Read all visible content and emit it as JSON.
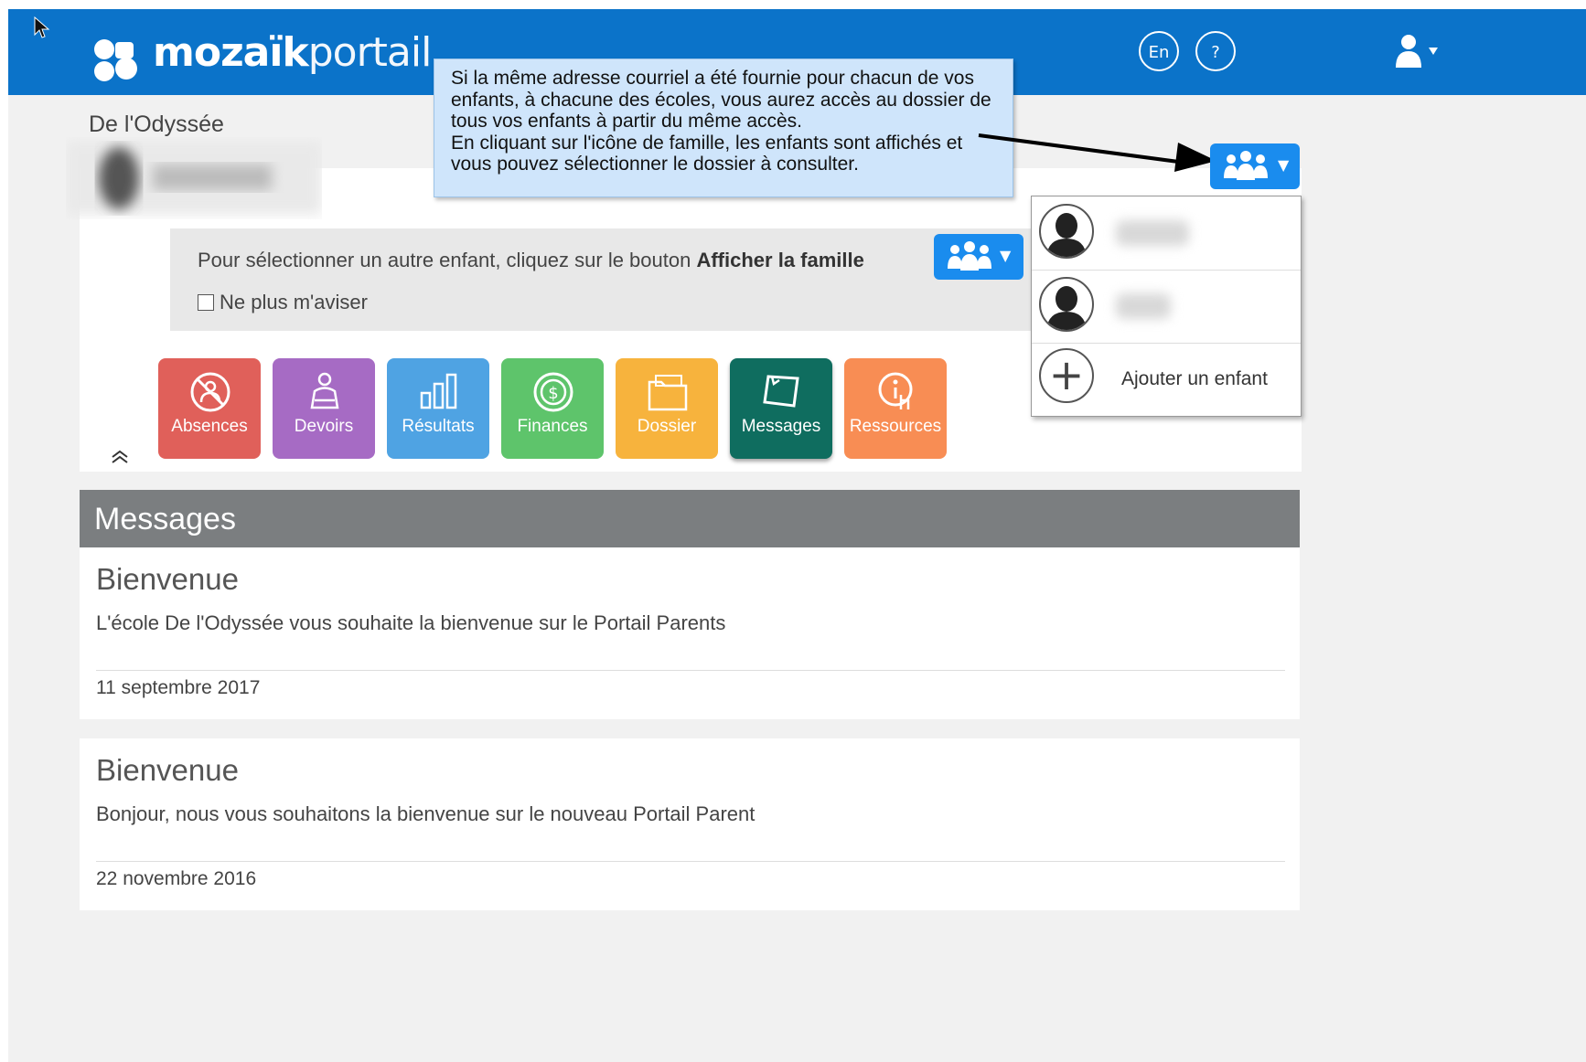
{
  "header": {
    "brand_bold": "mozaïk",
    "brand_light": "portail",
    "lang_button": "En",
    "help_button": "?",
    "color": "#0b73c9"
  },
  "school_name": "De l'Odyssée",
  "notice": {
    "text_prefix": "Pour sélectionner un autre enfant, cliquez sur le bouton ",
    "text_bold": "Afficher la famille",
    "checkbox_label": "Ne plus m'aviser"
  },
  "callout": {
    "lines": [
      "Si la même adresse courriel a été fournie pour chacun de vos",
      "enfants, à chacune des écoles, vous aurez accès au dossier de",
      "tous vos enfants à partir du même accès.",
      "En cliquant sur l'icône de famille, les enfants sont affichés et",
      "vous pouvez sélectionner le dossier à consulter."
    ]
  },
  "family_dropdown": {
    "add_child": "Ajouter un enfant"
  },
  "tiles": [
    {
      "label": "Absences",
      "color": "#e0605a",
      "icon": "absences-icon"
    },
    {
      "label": "Devoirs",
      "color": "#a66bc4",
      "icon": "devoirs-icon"
    },
    {
      "label": "Résultats",
      "color": "#4fa3e3",
      "icon": "resultats-icon"
    },
    {
      "label": "Finances",
      "color": "#5ec46b",
      "icon": "finances-icon"
    },
    {
      "label": "Dossier",
      "color": "#f7b33d",
      "icon": "dossier-icon"
    },
    {
      "label": "Messages",
      "color": "#0f6d5f",
      "icon": "messages-icon"
    },
    {
      "label": "Ressources",
      "color": "#f88d54",
      "icon": "ressources-icon"
    }
  ],
  "messages": {
    "title": "Messages",
    "items": [
      {
        "title": "Bienvenue",
        "body": "L'école De l'Odyssée vous souhaite la bienvenue sur le Portail Parents",
        "date": "11 septembre 2017"
      },
      {
        "title": "Bienvenue",
        "body": "Bonjour, nous vous souhaitons la bienvenue sur le nouveau Portail Parent",
        "date": "22 novembre 2016"
      }
    ]
  }
}
